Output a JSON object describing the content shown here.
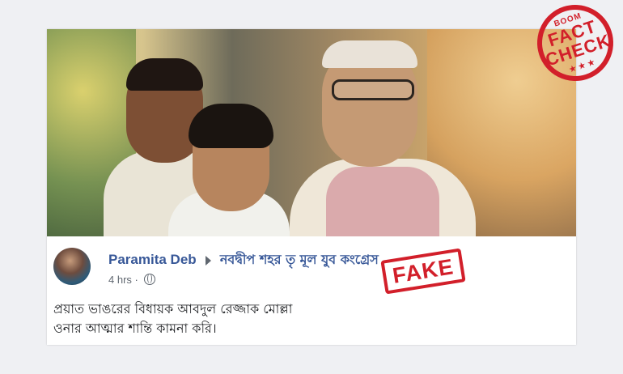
{
  "post": {
    "author": "Paramita Deb",
    "group": "নবদ্বীপ শহর তৃ   মূল যুব কংগ্রেস",
    "time": "4 hrs",
    "separator": "·",
    "privacy_icon": "globe-icon",
    "text_line1": "প্রয়াত ভাঙরের বিধায়ক আবদুল রেজ্জাক মোল্লা",
    "text_line2": "ওনার আত্মার শান্তি কামনা করি।"
  },
  "overlay": {
    "fake_label": "FAKE",
    "fact_check_brand": "BOOM",
    "fact_check_word1": "FACT",
    "fact_check_word2": "CHECK",
    "fact_check_stars": "★★★"
  },
  "colors": {
    "link": "#385898",
    "stamp": "#d21f2a",
    "background": "#eff0f3"
  }
}
